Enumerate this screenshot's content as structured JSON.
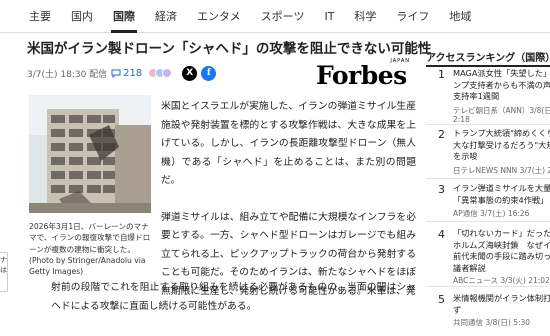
{
  "nav": {
    "tabs": [
      {
        "label": "主要",
        "active": false
      },
      {
        "label": "国内",
        "active": false
      },
      {
        "label": "国際",
        "active": true
      },
      {
        "label": "経済",
        "active": false
      },
      {
        "label": "エンタメ",
        "active": false
      },
      {
        "label": "スポーツ",
        "active": false
      },
      {
        "label": "IT",
        "active": false
      },
      {
        "label": "科学",
        "active": false
      },
      {
        "label": "ライフ",
        "active": false
      },
      {
        "label": "地域",
        "active": false
      }
    ]
  },
  "article": {
    "title": "米国がイラン製ドローン「シャヘド」の攻撃を阻止できない可能性",
    "date": "3/7(土) 18:30 配信",
    "comment_count": "218",
    "logo_small": "JAPAN",
    "logo_word": "Forbes",
    "caption": "2026年3月1日、バーレーンのマナマで、イランの報復攻撃で自爆ドローンが複数の建物に衝突した。(Photo by Stringer/Anadolu via Getty Images)",
    "paragraphs": [
      "米国とイスラエルが実施した、イランの弾道ミサイル生産施設や発射装置を標的とする攻撃作戦は、大きな成果を上げている。しかし、イランの長距離攻撃型ドローン（無人機）である「シャヘド」を止めることは、また別の問題だ。",
      "弾道ミサイルは、組み立てや配備に大規模なインフラを必要とする。一方、シャヘド型ドローンはガレージでも組み立てられる上、ピックアップトラックの荷台から発射することも可能だ。そのためイランは、新たなシャヘドをほぼ無期限に生産し、発射し続ける可能性がある。米軍は、発",
      "射前の段階でこれを阻止する取り組みを続ける必要があるものの、当面の間はシャヘドによる攻撃に直面し続ける可能性がある。"
    ]
  },
  "left_strip": "ナ は",
  "sidebar": {
    "heading": "アクセスランキング（国際）",
    "items": [
      {
        "rank": "1",
        "line1": "MAGA派女性「失望した」",
        "line2": "ンプ支持者からも不満の声",
        "line3": "支持率1週間",
        "source": "テレビ朝日系（ANN）3/8(日)",
        "count": "2:18"
      },
      {
        "rank": "2",
        "line1": "トランプ大統領\"締めくくり\"",
        "line2": "大な打撃受けるだろう\"大規模攻撃",
        "line3": "を示唆",
        "source": "日テレNEWS NNN 3/7(土) 2",
        "count": ""
      },
      {
        "rank": "3",
        "line1": "イラン弾道ミサイルを大量発射",
        "line2": "「異常事態の約束4作戦」",
        "line3": "",
        "source": "AP通信 3/7(土) 16:26",
        "count": ""
      },
      {
        "rank": "4",
        "line1": "「切れないカード」だった",
        "line2": "ホルムズ海峡封鎖　なぜイラン",
        "line3": "前代未聞の手段に踏み切った",
        "line3b": "議者解説",
        "source": "ABCニュース 3/3(火) 21:02",
        "count": ""
      },
      {
        "rank": "5",
        "line1": "米情報機関がイラン体制打倒",
        "line2": "ず",
        "line3": "",
        "source": "共同通信 3/8(日) 5:30",
        "count": ""
      }
    ]
  }
}
